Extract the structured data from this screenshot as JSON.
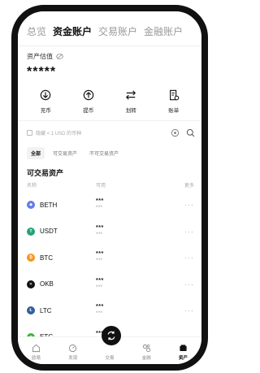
{
  "tabs": [
    {
      "label": "总览"
    },
    {
      "label": "资金账户"
    },
    {
      "label": "交易账户"
    },
    {
      "label": "金融账户"
    }
  ],
  "estimate_label": "资产估值",
  "balance_masked": "*****",
  "actions": [
    {
      "label": "充币",
      "icon": "deposit-icon"
    },
    {
      "label": "提币",
      "icon": "withdraw-icon"
    },
    {
      "label": "划转",
      "icon": "transfer-icon"
    },
    {
      "label": "账单",
      "icon": "bill-icon"
    }
  ],
  "hide_small": "隐藏 < 1 USD 的币种",
  "filters": [
    {
      "label": "全部"
    },
    {
      "label": "可交易资产"
    },
    {
      "label": "不可交易资产"
    }
  ],
  "section_title": "可交易资产",
  "columns": {
    "name": "名称",
    "available": "可用",
    "more": "更多"
  },
  "assets": [
    {
      "symbol": "BETH",
      "color": "#627EEA",
      "glyph": "◆",
      "amount": "***",
      "value": "***"
    },
    {
      "symbol": "USDT",
      "color": "#26A17B",
      "glyph": "T",
      "amount": "***",
      "value": "***"
    },
    {
      "symbol": "BTC",
      "color": "#F7931A",
      "glyph": "₿",
      "amount": "***",
      "value": "***"
    },
    {
      "symbol": "OKB",
      "color": "#111111",
      "glyph": "✕",
      "amount": "***",
      "value": "***"
    },
    {
      "symbol": "LTC",
      "color": "#345D9D",
      "glyph": "Ł",
      "amount": "***",
      "value": "***"
    },
    {
      "symbol": "ETC",
      "color": "#3AB83A",
      "glyph": "◆",
      "amount": "***",
      "value": "***"
    }
  ],
  "more_glyph": "···",
  "nav": [
    {
      "label": "欧易",
      "icon": "home-icon"
    },
    {
      "label": "发现",
      "icon": "discover-icon"
    },
    {
      "label": "交易",
      "icon": "trade-icon"
    },
    {
      "label": "金融",
      "icon": "finance-icon"
    },
    {
      "label": "资产",
      "icon": "assets-icon"
    }
  ]
}
